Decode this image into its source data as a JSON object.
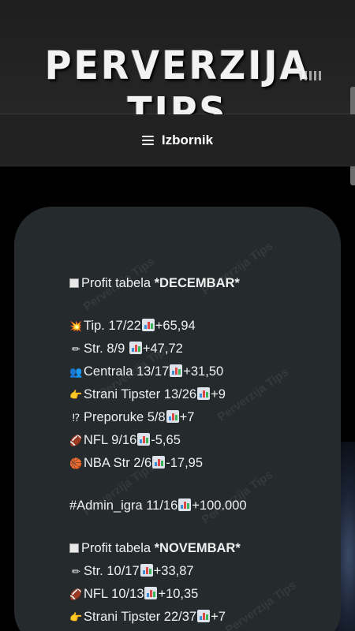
{
  "header": {
    "logo_text": "PERVERZIJA TIPS"
  },
  "nav": {
    "menu_label": "Izbornik"
  },
  "watermark_text": "Perverzija Tips",
  "post": {
    "december": {
      "title_prefix": "Profit tabela ",
      "title_bold": "*DECEMBAR*",
      "rows": [
        {
          "icon": "💥",
          "icon_name": "collision-icon",
          "text": "Tip. 17/22",
          "result": "+65,94"
        },
        {
          "icon": "✏",
          "icon_name": "pencil-icon",
          "text": "Str. 8/9 ",
          "result": "+47,72"
        },
        {
          "icon": "👥",
          "icon_name": "people-icon",
          "text": "Centrala 13/17",
          "result": "+31,50"
        },
        {
          "icon": "👉",
          "icon_name": "pointing-hand-icon",
          "text": "Strani Tipster 13/26",
          "result": "+9"
        },
        {
          "icon": "⁉",
          "icon_name": "exclamation-question-icon",
          "text": "Preporuke 5/8",
          "result": "+7"
        },
        {
          "icon": "🏈",
          "icon_name": "football-icon",
          "text": "NFL 9/16",
          "result": "-5,65"
        },
        {
          "icon": "🏀",
          "icon_name": "basketball-icon",
          "text": "NBA Str 2/6",
          "result": "-17,95"
        }
      ],
      "admin_text": "#Admin_igra 11/16",
      "admin_result": "+100.000"
    },
    "november": {
      "title_prefix": "Profit tabela ",
      "title_bold": "*NOVEMBAR*",
      "rows": [
        {
          "icon": "✏",
          "icon_name": "pencil-icon",
          "text": "Str. 10/17",
          "result": "+33,87"
        },
        {
          "icon": "🏈",
          "icon_name": "football-icon",
          "text": "NFL 10/13",
          "result": "+10,35"
        },
        {
          "icon": "👉",
          "icon_name": "pointing-hand-icon",
          "text": "Strani Tipster 22/37",
          "result": "+7"
        }
      ]
    }
  }
}
